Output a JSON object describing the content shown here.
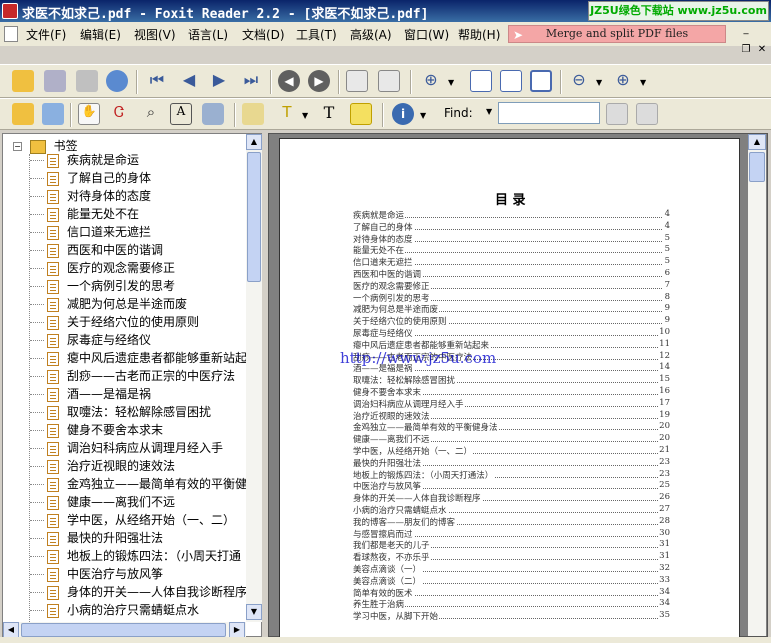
{
  "window": {
    "title": "求医不如求己.pdf - Foxit Reader 2.2 - [求医不如求己.pdf]",
    "ad_text": "JZ5U绿色下载站 www.jz5u.com"
  },
  "menu": [
    "文件(F)",
    "编辑(E)",
    "视图(V)",
    "语言(L)",
    "文档(D)",
    "工具(T)",
    "高级(A)",
    "窗口(W)",
    "帮助(H)"
  ],
  "merge_banner": "Merge and split PDF files",
  "toolbar": {
    "find_label": "Find:",
    "find_value": ""
  },
  "bookmarks": {
    "root": "书签",
    "items": [
      "疾病就是命运",
      "了解自己的身体",
      "对待身体的态度",
      "能量无处不在",
      "信口道来无遮拦",
      "西医和中医的谐调",
      "医疗的观念需要修正",
      "一个病例引发的思考",
      "减肥为何总是半途而废",
      "关于经络穴位的使用原则",
      "尿毒症与经络仪",
      "瘪中风后遗症患者都能够重新站起",
      "刮痧——古老而正宗的中医疗法",
      "酒——是福是祸",
      "取嚏法：轻松解除感冒困扰",
      "健身不要舍本求末",
      "调治妇科病应从调理月经入手",
      "治疗近视眼的速效法",
      "金鸡独立——最简单有效的平衡健",
      "健康——离我们不远",
      "学中医，从经络开始（一、二）",
      "最快的升阳强壮法",
      "地板上的锻炼四法：（小周天打通",
      "中医治疗与放风筝",
      "身体的开关——人体自我诊断程序",
      "小病的治疗只需蜻蜓点水"
    ]
  },
  "document": {
    "toc_title": "目  录",
    "watermark": "http://www.jz5u.com",
    "entries": [
      {
        "t": "疾病就是命运",
        "n": "4"
      },
      {
        "t": "了解自己的身体",
        "n": "4"
      },
      {
        "t": "对待身体的态度",
        "n": "5"
      },
      {
        "t": "能量无处不在",
        "n": "5"
      },
      {
        "t": "信口道来无遮拦",
        "n": "5"
      },
      {
        "t": "西医和中医的谐调",
        "n": "6"
      },
      {
        "t": "医疗的观念需要修正",
        "n": "7"
      },
      {
        "t": "一个病例引发的思考",
        "n": "8"
      },
      {
        "t": "减肥为何总是半途而废",
        "n": "9"
      },
      {
        "t": "关于经络穴位的使用原则",
        "n": "9"
      },
      {
        "t": "尿毒症与经络仪",
        "n": "10"
      },
      {
        "t": "瘪中风后遗症患者都能够重新站起来",
        "n": "11"
      },
      {
        "t": "刮痧——古老而正宗的中医疗法",
        "n": "12"
      },
      {
        "t": "酒——是福是祸",
        "n": "14"
      },
      {
        "t": "取嚏法：轻松解除感冒困扰",
        "n": "15"
      },
      {
        "t": "健身不要舍本求末",
        "n": "16"
      },
      {
        "t": "调治妇科病应从调理月经入手",
        "n": "17"
      },
      {
        "t": "治疗近视眼的速效法",
        "n": "19"
      },
      {
        "t": "金鸡独立——最简单有效的平衡健身法",
        "n": "20"
      },
      {
        "t": "健康——离我们不远",
        "n": "20"
      },
      {
        "t": "学中医，从经络开始（一、二）",
        "n": "21"
      },
      {
        "t": "最快的升阳强壮法",
        "n": "23"
      },
      {
        "t": "地板上的锻炼四法：（小周天打通法）",
        "n": "23"
      },
      {
        "t": "中医治疗与放风筝",
        "n": "25"
      },
      {
        "t": "身体的开关——人体自我诊断程序",
        "n": "26"
      },
      {
        "t": "小病的治疗只需蜻蜓点水",
        "n": "27"
      },
      {
        "t": "我的博客——朋友们的博客",
        "n": "28"
      },
      {
        "t": "与感冒擦肩而过",
        "n": "30"
      },
      {
        "t": "我们都是老天的儿子",
        "n": "31"
      },
      {
        "t": "看球熬夜，不亦乐乎",
        "n": "31"
      },
      {
        "t": "美容点滴谈（一）",
        "n": "32"
      },
      {
        "t": "美容点滴谈（二）",
        "n": "33"
      },
      {
        "t": "简单有效的医术",
        "n": "34"
      },
      {
        "t": "养生胜于治病",
        "n": "34"
      },
      {
        "t": "学习中医，从脚下开始",
        "n": "35"
      }
    ]
  }
}
